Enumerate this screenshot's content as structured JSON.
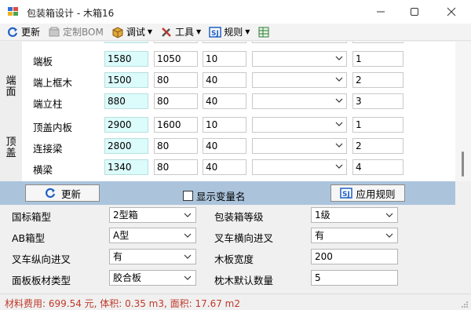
{
  "window": {
    "title": "包装箱设计 - 木箱16",
    "minimize_icon": "minimize-icon",
    "maximize_icon": "maximize-icon",
    "close_icon": "close-icon"
  },
  "toolbar": {
    "refresh_label": "更新",
    "custom_bom_label": "定制BOM",
    "debug_label": "调试",
    "tools_label": "工具",
    "rules_label": "规则"
  },
  "groups": {
    "end_label": "端面",
    "top_label": "顶盖"
  },
  "rows": [
    {
      "name": "端板",
      "v1": "1580",
      "v2": "1050",
      "v3": "10",
      "dd": "",
      "v5": "1"
    },
    {
      "name": "端上框木",
      "v1": "1500",
      "v2": "80",
      "v3": "40",
      "dd": "",
      "v5": "2"
    },
    {
      "name": "端立柱",
      "v1": "880",
      "v2": "80",
      "v3": "40",
      "dd": "",
      "v5": "3"
    },
    {
      "name": "顶盖内板",
      "v1": "2900",
      "v2": "1600",
      "v3": "10",
      "dd": "",
      "v5": "1"
    },
    {
      "name": "连接梁",
      "v1": "2800",
      "v2": "80",
      "v3": "40",
      "dd": "",
      "v5": "2"
    },
    {
      "name": "横梁",
      "v1": "1340",
      "v2": "80",
      "v3": "40",
      "dd": "",
      "v5": "4"
    }
  ],
  "action_bar": {
    "refresh_button": "更新",
    "show_var_names": "显示变量名",
    "apply_rules_button": "应用规则",
    "show_var_names_checked": false
  },
  "properties": {
    "national_box_type_label": "国标箱型",
    "national_box_type_value": "2型箱",
    "package_grade_label": "包装箱等级",
    "package_grade_value": "1级",
    "ab_box_type_label": "AB箱型",
    "ab_box_type_value": "A型",
    "forklift_lateral_label": "叉车横向进叉",
    "forklift_lateral_value": "有",
    "forklift_longitudinal_label": "叉车纵向进叉",
    "forklift_longitudinal_value": "有",
    "plank_width_label": "木板宽度",
    "plank_width_value": "200",
    "panel_material_label": "面板板材类型",
    "panel_material_value": "胶合板",
    "sleeper_default_count_label": "枕木默认数量",
    "sleeper_default_count_value": "5"
  },
  "status": {
    "text": "材料费用: 699.54 元, 体积: 0.35 m3, 面积: 17.67 m2"
  },
  "colors": {
    "highlight_cell": "#dcfbfb",
    "action_bar": "#abc4dc",
    "status_text": "#c0392b"
  }
}
